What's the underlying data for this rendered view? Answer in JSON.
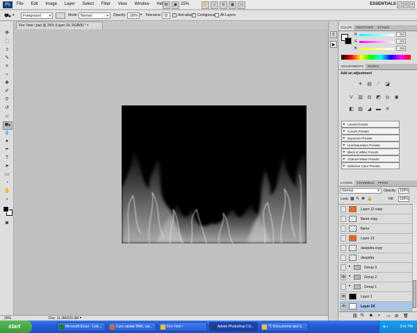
{
  "menubar": {
    "app_logo": "Ps",
    "menus": [
      "File",
      "Edit",
      "Image",
      "Layer",
      "Select",
      "Filter",
      "View",
      "Window",
      "Help"
    ],
    "zoom": "25%",
    "workspace": "ESSENTIALS"
  },
  "options_bar": {
    "fill_source": "Foreground",
    "mode_label": "Mode:",
    "mode_value": "Normal",
    "opacity_label": "Opacity:",
    "opacity_value": "100%",
    "tolerance_label": "Tolerance:",
    "tolerance_value": "32",
    "anti_alias_label": "Anti-alias",
    "contiguous_label": "Contiguous",
    "all_layers_label": "All Layers"
  },
  "document": {
    "tab_title": "Fire Time !.psd @ 25% (Layer 24, RGB/8) *",
    "zoom_status": "25%",
    "doc_size": "Doc: 11.3M/220.9M"
  },
  "color_panel": {
    "tabs": [
      "COLOR",
      "SWATCHES",
      "STYLES"
    ],
    "r_label": "R",
    "r_value": "255",
    "g_label": "G",
    "g_value": "255",
    "b_label": "B",
    "b_value": "255"
  },
  "adjustments_panel": {
    "tabs": [
      "ADJUSTMENTS",
      "MASKS"
    ],
    "heading": "Add an adjustment",
    "presets": [
      "Levels Presets",
      "Curves Presets",
      "Exposure Presets",
      "Hue/Saturation Presets",
      "Black & White Presets",
      "Channel Mixer Presets",
      "Selective Color Presets"
    ]
  },
  "layers_panel": {
    "tabs": [
      "LAYERS",
      "CHANNELS",
      "PATHS"
    ],
    "blend_mode": "Normal",
    "opacity_label": "Opacity:",
    "opacity_value": "100%",
    "lock_label": "Lock:",
    "fill_label": "Fill:",
    "fill_value": "100%",
    "layers": [
      {
        "name": "Layer 13 copy",
        "thumb": "orange",
        "visible": false,
        "type": "layer"
      },
      {
        "name": "flame copy",
        "thumb": "trans",
        "visible": false,
        "type": "layer"
      },
      {
        "name": "flame",
        "thumb": "trans",
        "visible": false,
        "type": "layer"
      },
      {
        "name": "Layer 13",
        "thumb": "orange",
        "visible": false,
        "type": "layer"
      },
      {
        "name": "daspidra copy",
        "thumb": "trans",
        "visible": false,
        "type": "layer"
      },
      {
        "name": "daspidra",
        "thumb": "trans",
        "visible": false,
        "type": "layer"
      },
      {
        "name": "Group 3",
        "thumb": "folder",
        "visible": false,
        "type": "group"
      },
      {
        "name": "Group 2",
        "thumb": "folder",
        "visible": true,
        "type": "group"
      },
      {
        "name": "Group 1",
        "thumb": "folder",
        "visible": false,
        "type": "group"
      },
      {
        "name": "Layer 1",
        "thumb": "black",
        "visible": true,
        "type": "layer"
      },
      {
        "name": "Layer 24",
        "thumb": "white",
        "visible": true,
        "type": "layer",
        "selected": true
      }
    ]
  },
  "taskbar": {
    "start_label": "start",
    "tasks": [
      {
        "label": "Microsoft Excel - Calc...",
        "active": false
      },
      {
        "label": "Curs valutar BNR, cal...",
        "active": false
      },
      {
        "label": "Fire Time !",
        "active": false
      },
      {
        "label": "Adobe Photoshop CS...",
        "active": true
      },
      {
        "label": "\"C:\\Documents and S...",
        "active": false
      }
    ],
    "clock": "3:41 PM"
  },
  "colors": {
    "selected_layer": "#a9c6e8",
    "orange_thumb": "#f26a12",
    "taskbar_blue": "#245dd7",
    "start_green": "#3a9a3a"
  }
}
